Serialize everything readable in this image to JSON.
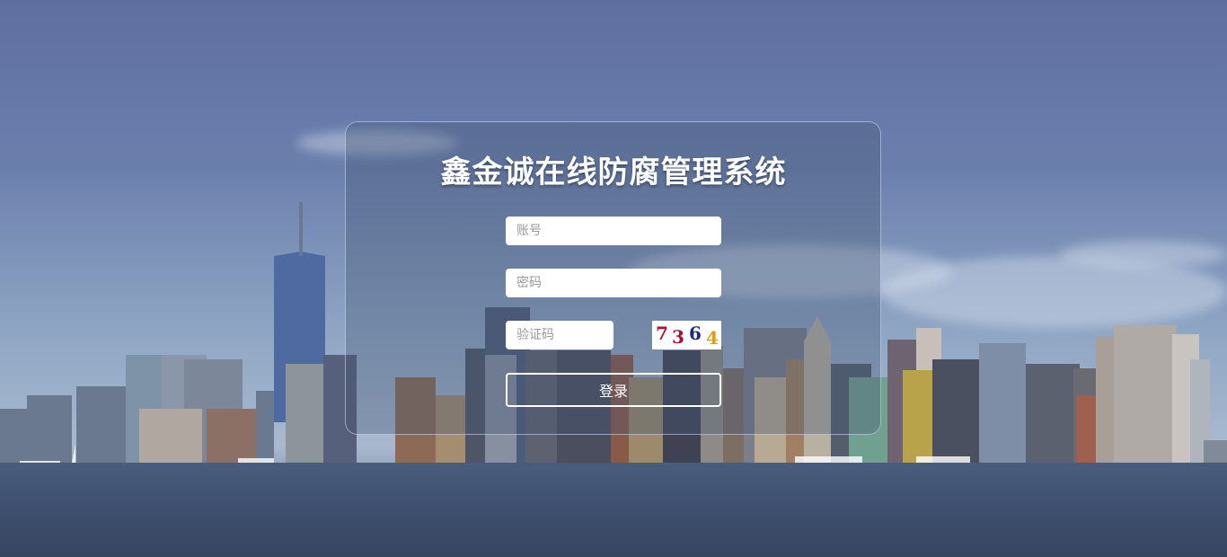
{
  "title": "鑫金诚在线防腐管理系统",
  "form": {
    "account_placeholder": "账号",
    "password_placeholder": "密码",
    "captcha_placeholder": "验证码",
    "captcha_chars": [
      "7",
      "3",
      "6",
      "4"
    ],
    "login_label": "登录"
  },
  "colors": {
    "captcha": [
      "#b0102a",
      "#a01030",
      "#1a2a8a",
      "#e0a000"
    ]
  }
}
